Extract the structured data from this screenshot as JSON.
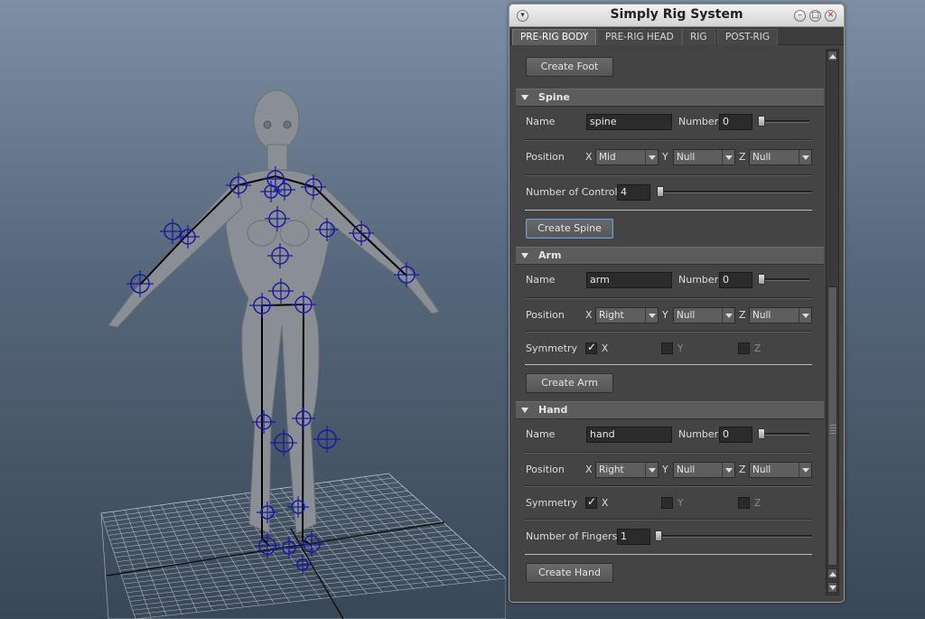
{
  "window": {
    "title": "Simply Rig System",
    "menu_glyph": "▾",
    "minimize_glyph": "–",
    "maximize_glyph": "□",
    "close_glyph": "✕"
  },
  "tabs": [
    {
      "label": "PRE-RIG BODY",
      "active": true
    },
    {
      "label": "PRE-RIG HEAD",
      "active": false
    },
    {
      "label": "RIG",
      "active": false
    },
    {
      "label": "POST-RIG",
      "active": false
    }
  ],
  "foot": {
    "create_label": "Create Foot"
  },
  "spine": {
    "header": "Spine",
    "name_label": "Name",
    "name_value": "spine",
    "number_label": "Number",
    "number_value": "0",
    "position_label": "Position",
    "x_axis": "X",
    "y_axis": "Y",
    "z_axis": "Z",
    "x_value": "Mid",
    "y_value": "Null",
    "z_value": "Null",
    "controls_label": "Number of Controls",
    "controls_value": "4",
    "create_label": "Create Spine"
  },
  "arm": {
    "header": "Arm",
    "name_label": "Name",
    "name_value": "arm",
    "number_label": "Number",
    "number_value": "0",
    "position_label": "Position",
    "x_axis": "X",
    "y_axis": "Y",
    "z_axis": "Z",
    "x_value": "Right",
    "y_value": "Null",
    "z_value": "Null",
    "symmetry_label": "Symmetry",
    "sym_x": "X",
    "sym_y": "Y",
    "sym_z": "Z",
    "sym_x_checked": true,
    "sym_y_checked": false,
    "sym_z_checked": false,
    "create_label": "Create Arm"
  },
  "hand": {
    "header": "Hand",
    "name_label": "Name",
    "name_value": "hand",
    "number_label": "Number",
    "number_value": "0",
    "position_label": "Position",
    "x_axis": "X",
    "y_axis": "Y",
    "z_axis": "Z",
    "x_value": "Right",
    "y_value": "Null",
    "z_value": "Null",
    "symmetry_label": "Symmetry",
    "sym_x": "X",
    "sym_y": "Y",
    "sym_z": "Z",
    "sym_x_checked": true,
    "sym_y_checked": false,
    "sym_z_checked": false,
    "fingers_label": "Number of Fingers",
    "fingers_value": "1",
    "create_label": "Create Hand"
  },
  "colors": {
    "viewport_top": "#7f8fa3",
    "viewport_bottom": "#3a4756",
    "panel_bg": "#444444",
    "locator": "#1a1a9a"
  }
}
